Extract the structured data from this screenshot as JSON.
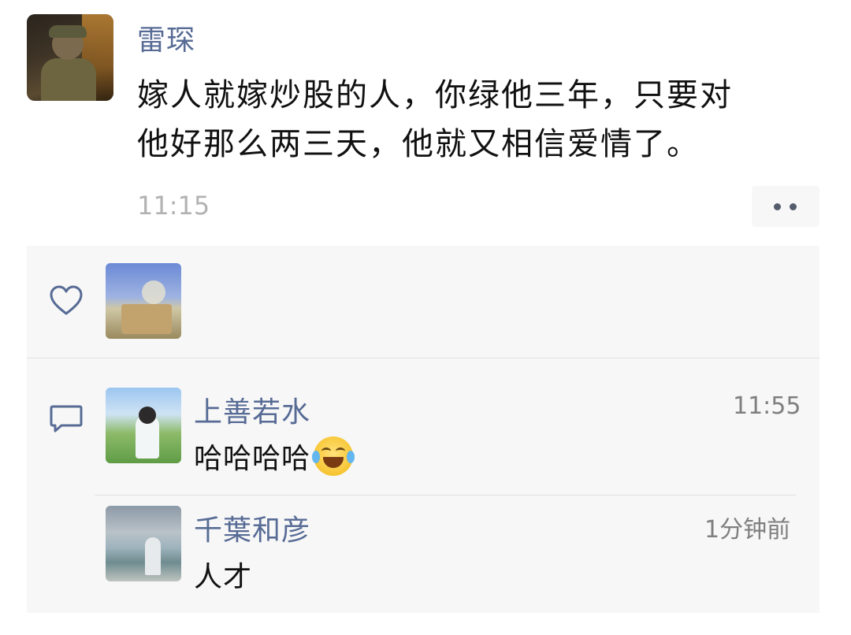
{
  "post": {
    "author": "雷琛",
    "text_line1": "嫁人就嫁炒股的人，你绿他三年，只要对",
    "text_line2": "他好那么两三天，他就又相信爱情了。",
    "time": "11:15"
  },
  "icons": {
    "more": "more-dots-icon",
    "like": "heart-icon",
    "comment": "comment-bubble-icon",
    "emoji": "laughing-tears-emoji"
  },
  "comments": [
    {
      "name": "上善若水",
      "text": "哈哈哈哈",
      "time": "11:55"
    },
    {
      "name": "千葉和彦",
      "text": "人才",
      "time": "1分钟前"
    }
  ],
  "colors": {
    "name_link": "#576b95",
    "panel_bg": "#f7f7f7",
    "timestamp": "#b2b2b2"
  }
}
